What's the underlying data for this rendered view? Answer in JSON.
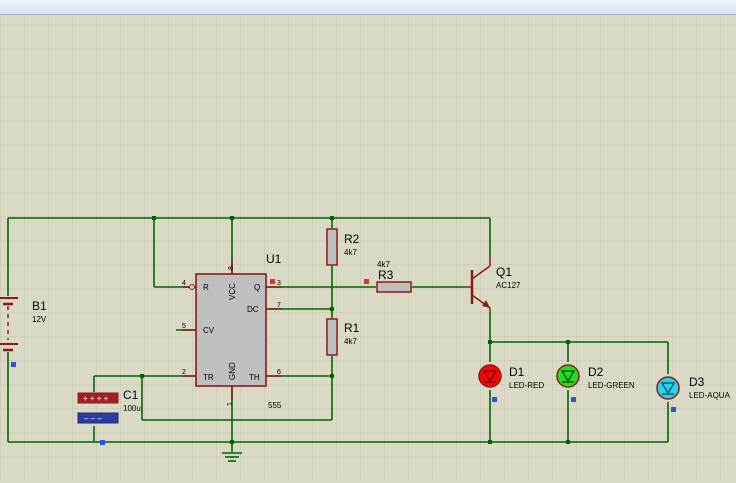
{
  "window": {
    "title": ""
  },
  "colors": {
    "background": "#d9d9c6",
    "grid": "#c3c3ad",
    "wire": "#006400",
    "component": "#8b1a1a",
    "component_fill": "#bfbfbf",
    "junction": "#006400",
    "pin_marker_red": "#e03030",
    "pin_marker_blue": "#3050e0",
    "led_red": "#ff0000",
    "led_green": "#22dd22",
    "led_aqua": "#22d4ee"
  },
  "components": {
    "u1": {
      "ref": "U1",
      "part": "555",
      "pins": {
        "r": "R",
        "vcc": "VCC",
        "q": "Q",
        "dc": "DC",
        "cv": "CV",
        "tr": "TR",
        "gnd": "GND",
        "th": "TH"
      },
      "pin_numbers": {
        "p4": "4",
        "p8": "8",
        "p3": "3",
        "p7": "7",
        "p5": "5",
        "p2": "2",
        "p1": "1",
        "p6": "6"
      }
    },
    "r1": {
      "ref": "R1",
      "value": "4k7"
    },
    "r2": {
      "ref": "R2",
      "value": "4k7"
    },
    "r3": {
      "ref": "R3",
      "value": "4k7"
    },
    "q1": {
      "ref": "Q1",
      "value": "AC127"
    },
    "b1": {
      "ref": "B1",
      "value": "12V"
    },
    "c1": {
      "ref": "C1",
      "value": "100u"
    },
    "d1": {
      "ref": "D1",
      "value": "LED-RED"
    },
    "d2": {
      "ref": "D2",
      "value": "LED-GREEN"
    },
    "d3": {
      "ref": "D3",
      "value": "LED-AQUA"
    }
  }
}
